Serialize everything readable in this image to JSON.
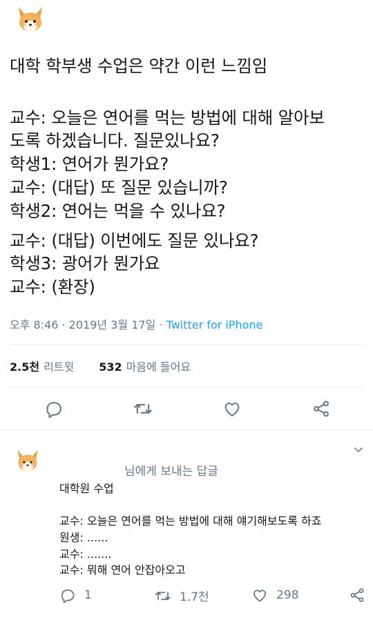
{
  "tweet": {
    "avatar_icon": "corgi-avatar",
    "lines": [
      "대학 학부생 수업은 약간 이런 느낌임",
      "",
      "교수: 오늘은 연어를 먹는 방법에 대해 알아보",
      "도록 하겠습니다. 질문있나요?",
      "학생1: 연어가 뭔가요?",
      "교수: (대답) 또 질문 있습니까?",
      "학생2: 연어는 먹을 수 있나요?",
      "교수: (대답) 이번에도 질문 있나요?",
      "학생3: 광어가 뭔가요",
      "교수: (환장)"
    ],
    "meta_time": "오후 8:46 · 2019년 3월 17일 · ",
    "meta_source": "Twitter for iPhone",
    "retweets_count": "2.5천",
    "retweets_label": "리트윗",
    "likes_count": "532",
    "likes_label": "마음에 들어요"
  },
  "actions": [
    "reply-icon",
    "retweet-icon",
    "like-icon",
    "share-icon"
  ],
  "reply": {
    "avatar_icon": "corgi-avatar",
    "replying_to": "님에게 보내는 답글",
    "lines": [
      "대학원 수업",
      "",
      "교수: 오늘은 연어를 먹는 방법에 대해 얘기해보도록 하죠",
      "원생: ......",
      "교수: .......",
      "교수: 뭐해 연어 안잡아오고"
    ],
    "reply_count": "1",
    "retweet_count": "1.7천",
    "like_count": "298"
  },
  "colors": {
    "text": "#14171a",
    "secondary": "#657786",
    "accent": "#1da1f2",
    "divider": "#e6ecf0"
  }
}
